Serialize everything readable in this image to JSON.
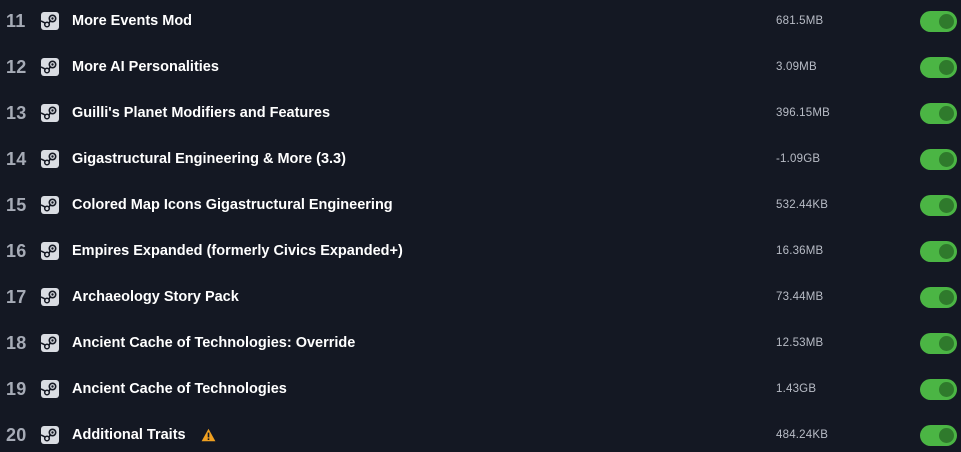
{
  "mods": [
    {
      "index": "11",
      "name": "More Events Mod",
      "size": "681.5MB",
      "enabled": true,
      "icon": "steam-icon",
      "warning": false
    },
    {
      "index": "12",
      "name": "More AI Personalities",
      "size": "3.09MB",
      "enabled": true,
      "icon": "steam-icon",
      "warning": false
    },
    {
      "index": "13",
      "name": "Guilli's Planet Modifiers and Features",
      "size": "396.15MB",
      "enabled": true,
      "icon": "steam-icon",
      "warning": false
    },
    {
      "index": "14",
      "name": "Gigastructural Engineering & More (3.3)",
      "size": "-1.09GB",
      "enabled": true,
      "icon": "steam-icon",
      "warning": false
    },
    {
      "index": "15",
      "name": "Colored Map Icons Gigastructural Engineering",
      "size": "532.44KB",
      "enabled": true,
      "icon": "steam-icon",
      "warning": false
    },
    {
      "index": "16",
      "name": "Empires Expanded (formerly Civics Expanded+)",
      "size": "16.36MB",
      "enabled": true,
      "icon": "steam-icon",
      "warning": false
    },
    {
      "index": "17",
      "name": "Archaeology Story Pack",
      "size": "73.44MB",
      "enabled": true,
      "icon": "steam-icon",
      "warning": false
    },
    {
      "index": "18",
      "name": "Ancient Cache of Technologies: Override",
      "size": "12.53MB",
      "enabled": true,
      "icon": "steam-icon",
      "warning": false
    },
    {
      "index": "19",
      "name": "Ancient Cache of Technologies",
      "size": "1.43GB",
      "enabled": true,
      "icon": "steam-icon",
      "warning": false
    },
    {
      "index": "20",
      "name": "Additional Traits",
      "size": "484.24KB",
      "enabled": true,
      "icon": "steam-icon",
      "warning": true
    }
  ],
  "colors": {
    "background": "#141823",
    "toggle_on": "#4bb544",
    "toggle_knob": "#2f7a2c",
    "warning": "#f0a020"
  }
}
